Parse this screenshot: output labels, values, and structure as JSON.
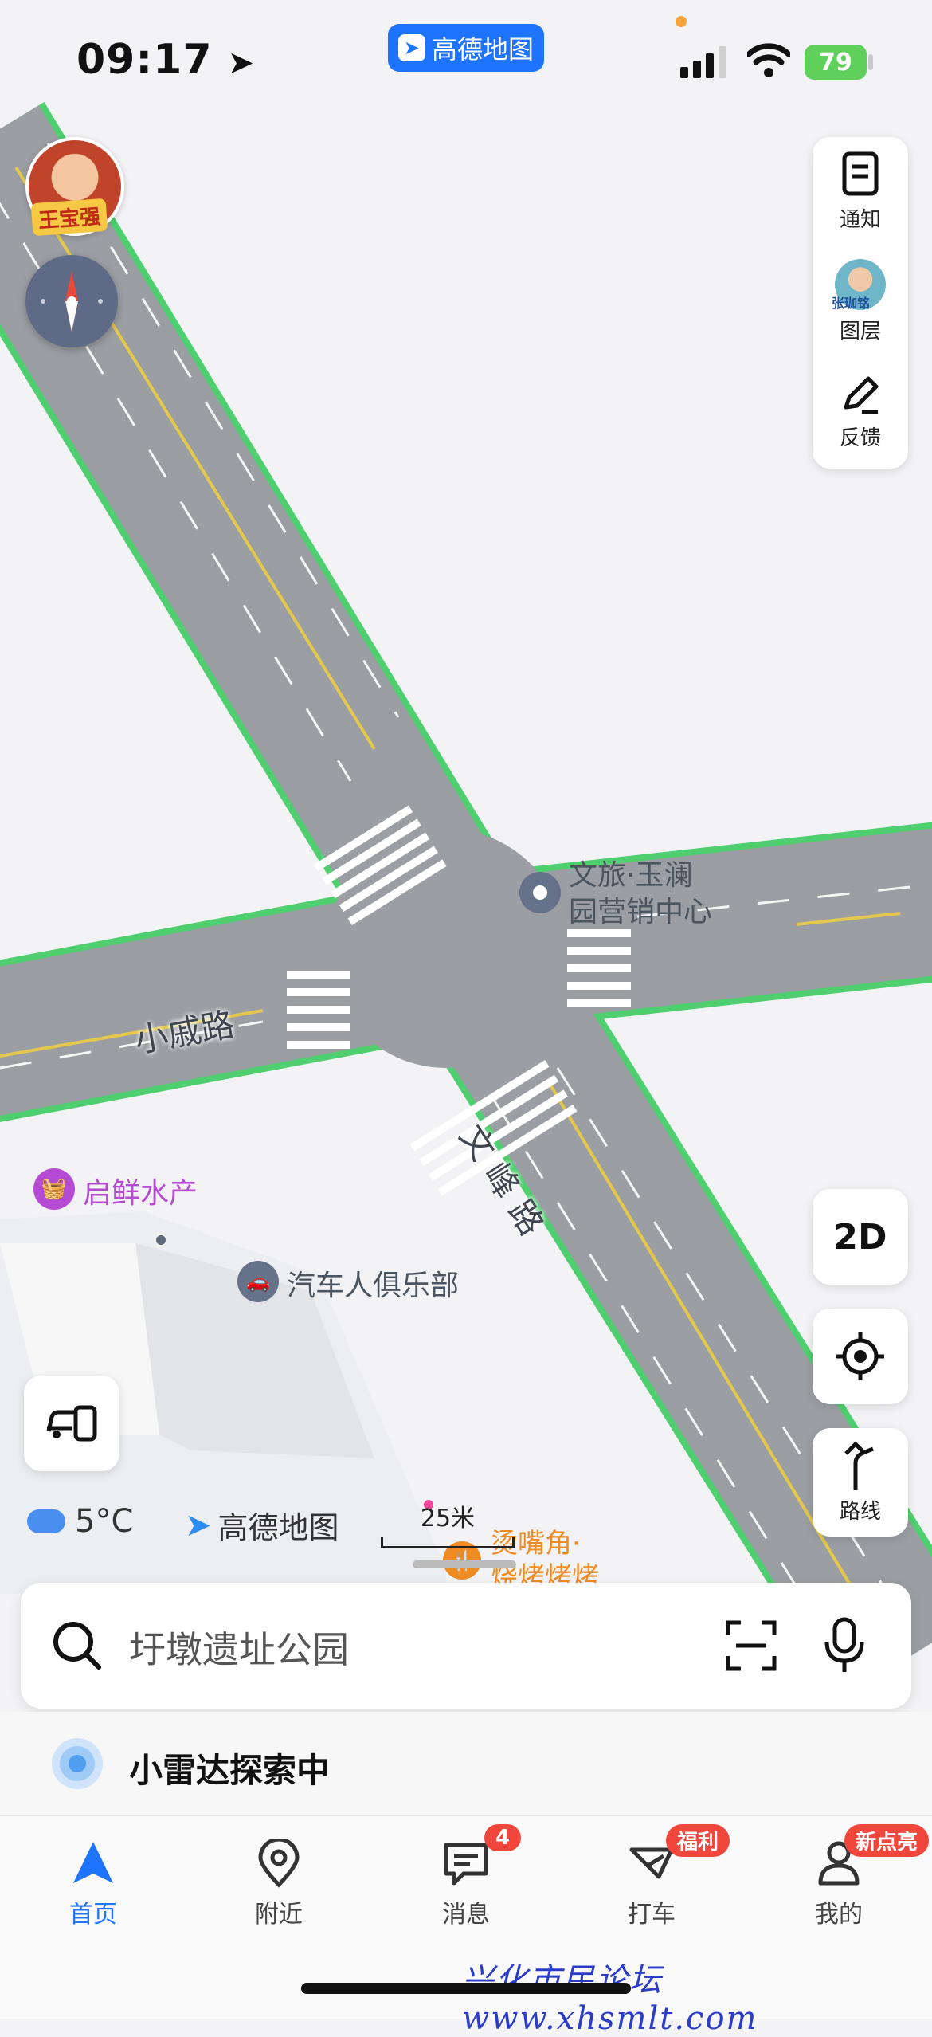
{
  "status_bar": {
    "time": "09:17",
    "app_pill": "高德地图",
    "battery": "79"
  },
  "avatar_tag": "王宝强",
  "right_panel": {
    "items": [
      {
        "label": "通知"
      },
      {
        "label": "图层",
        "avatar_tag": "张珈铭"
      },
      {
        "label": "反馈"
      }
    ]
  },
  "map_buttons": {
    "mode_2d": "2D",
    "route": "路线"
  },
  "map_labels": {
    "poi_wenlv": [
      "文旅·玉澜",
      "园营销中心"
    ],
    "road_xiaowei": "小戚路",
    "road_wenfeng": "文峰路",
    "poi_fish": "启鲜水产",
    "poi_car_club": "汽车人俱乐部",
    "poi_food": [
      "烫嘴角·",
      "烧烤烤烤"
    ]
  },
  "weather": {
    "temp": "5°C"
  },
  "brand": "高德地图",
  "scale": "25米",
  "search": {
    "placeholder": "圩墩遗址公园"
  },
  "radar": {
    "text": "小雷达探索中"
  },
  "tabs": [
    {
      "label": "首页",
      "active": true
    },
    {
      "label": "附近"
    },
    {
      "label": "消息",
      "badge": "4"
    },
    {
      "label": "打车",
      "badge": "福利"
    },
    {
      "label": "我的",
      "badge": "新点亮"
    }
  ],
  "watermark": "兴化市民论坛 www.xhsmlt.com",
  "colors": {
    "accent": "#1e74ff",
    "road": "#9b9ea3",
    "road_edge": "#4fcf6f",
    "badge": "#f0463c"
  }
}
